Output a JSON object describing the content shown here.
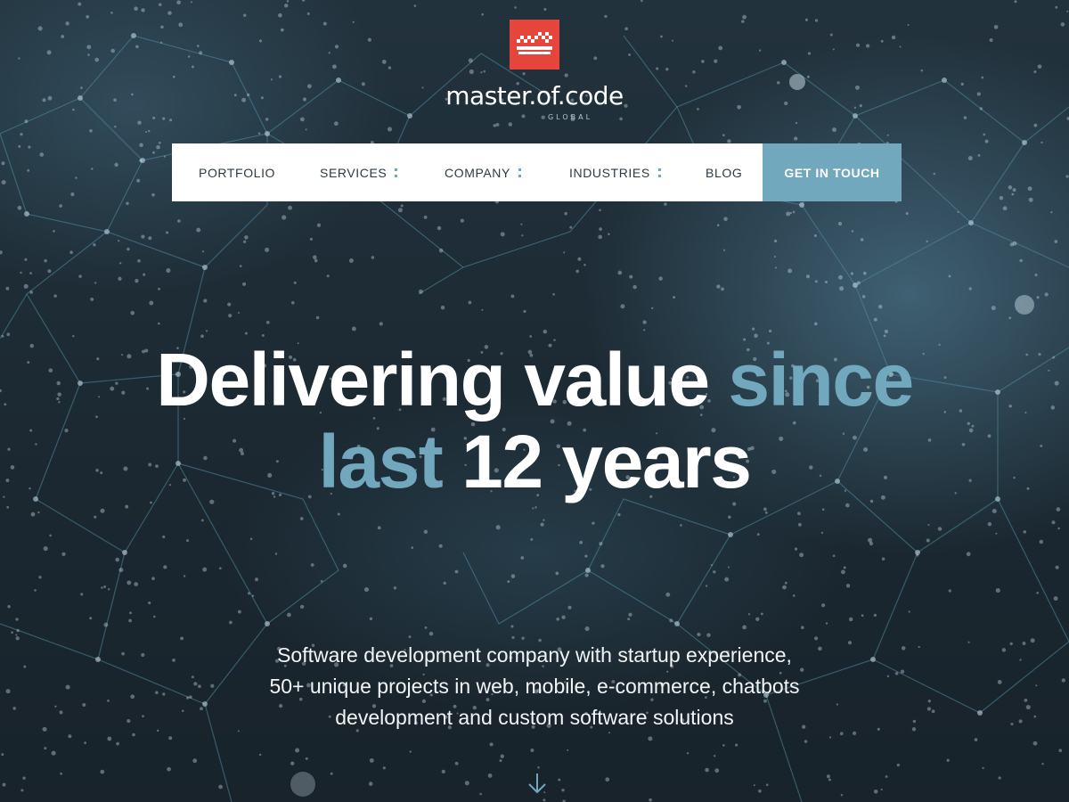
{
  "brand": {
    "name": "master.of.code",
    "subtitle": "GLOBAL",
    "logo_color": "#e5453b"
  },
  "nav": {
    "items": [
      {
        "label": "PORTFOLIO",
        "has_submenu": false
      },
      {
        "label": "SERVICES",
        "has_submenu": true
      },
      {
        "label": "COMPANY",
        "has_submenu": true
      },
      {
        "label": "INDUSTRIES",
        "has_submenu": true
      },
      {
        "label": "BLOG",
        "has_submenu": false
      }
    ],
    "cta_label": "GET IN TOUCH",
    "accent_color": "#72a8bd"
  },
  "hero": {
    "headline_line1_plain": "Delivering value",
    "headline_line1_accent": "since",
    "headline_line2_accent": "last",
    "headline_line2_plain": "12 years",
    "tagline_lines": [
      "Software development company with startup experience,",
      "50+ unique projects in web, mobile, e-commerce, chatbots",
      "development and custom software solutions"
    ],
    "scroll_icon": "arrow-down-icon"
  }
}
